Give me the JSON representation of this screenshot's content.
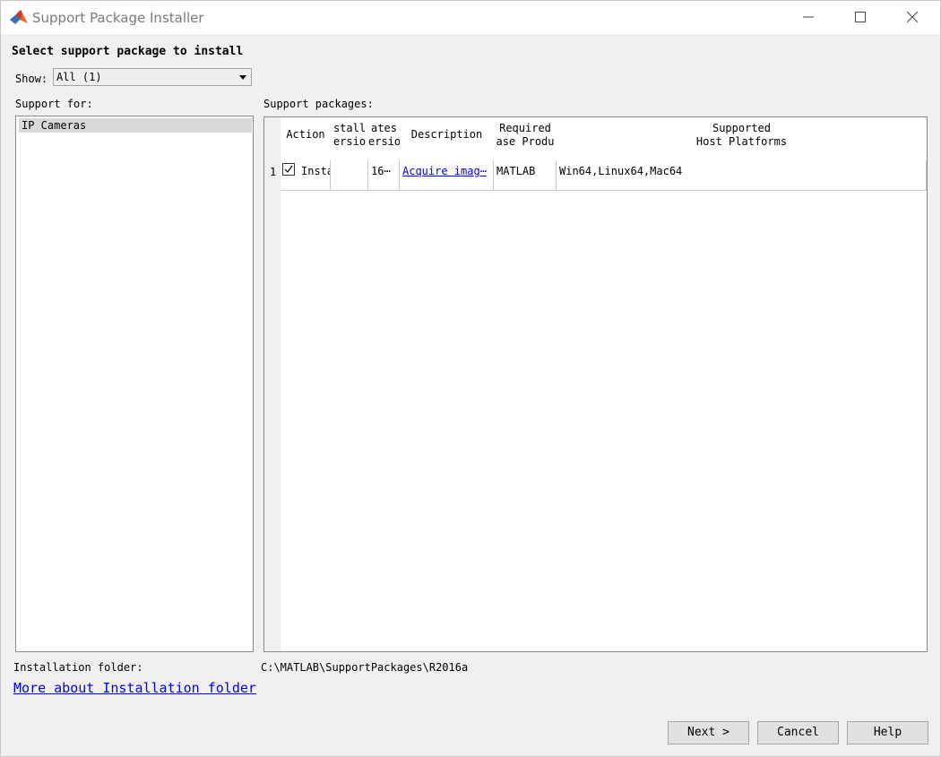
{
  "window": {
    "title": "Support Package Installer"
  },
  "main": {
    "heading": "Select support package to install",
    "show": {
      "label": "Show:",
      "value": "All (1)"
    },
    "support_for": {
      "label": "Support for:",
      "items": [
        "IP Cameras"
      ]
    },
    "packages": {
      "label": "Support packages:",
      "columns": [
        {
          "line1": "",
          "line2": "Action"
        },
        {
          "line1": "stall",
          "line2": "ersio"
        },
        {
          "line1": "ates",
          "line2": "ersio"
        },
        {
          "line1": "",
          "line2": "Description"
        },
        {
          "line1": "Required",
          "line2": "ase Produ"
        },
        {
          "line1": "Supported",
          "line2": "Host Platforms"
        }
      ],
      "rows": [
        {
          "num": "1",
          "action_checked": true,
          "action": "Insta",
          "installed_version": "",
          "latest_version": "16⋯",
          "description": "Acquire imag⋯",
          "required_product": "MATLAB",
          "platforms": "Win64,Linux64,Mac64"
        }
      ]
    }
  },
  "footer": {
    "install_folder_label": "Installation folder:",
    "install_folder_path": "C:\\MATLAB\\SupportPackages\\R2016a",
    "more_link": "More about Installation folder",
    "buttons": {
      "next": "Next >",
      "cancel": "Cancel",
      "help": "Help"
    }
  },
  "colors": {
    "accent_link": "#0000ee",
    "matlab_logo_orange": "#e16737",
    "matlab_logo_blue": "#3b6fb6"
  }
}
